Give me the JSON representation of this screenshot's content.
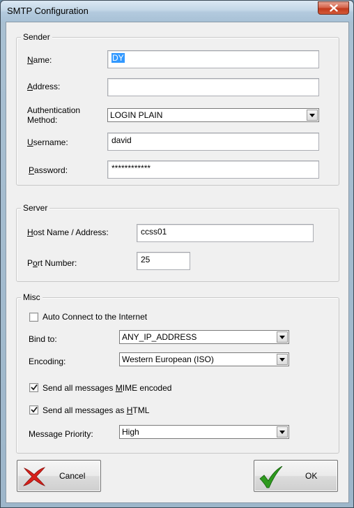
{
  "window": {
    "title": "SMTP Configuration"
  },
  "sender": {
    "legend": "Sender",
    "name_label_pre": "",
    "name_label_ul": "N",
    "name_label_post": "ame:",
    "name_value": "DY",
    "address_label_pre": "",
    "address_label_ul": "A",
    "address_label_post": "ddress:",
    "address_value": "",
    "auth_label_line1": "Authentication",
    "auth_label_line2": "Method:",
    "auth_value": "LOGIN PLAIN",
    "username_label_pre": "",
    "username_label_ul": "U",
    "username_label_post": "sername:",
    "username_value": "david",
    "password_label_pre": "",
    "password_label_ul": "P",
    "password_label_post": "assword:",
    "password_value": "************"
  },
  "server": {
    "legend": "Server",
    "host_label_pre": "",
    "host_label_ul": "H",
    "host_label_post": "ost Name / Address:",
    "host_value": "ccss01",
    "port_label_pre": "P",
    "port_label_ul": "o",
    "port_label_post": "rt Number:",
    "port_value": "25"
  },
  "misc": {
    "legend": "Misc",
    "auto_connect_label": "Auto Connect to the Internet",
    "auto_connect_checked": false,
    "bind_label": "Bind to:",
    "bind_value": "ANY_IP_ADDRESS",
    "encoding_label": "Encoding:",
    "encoding_value": "Western European (ISO)",
    "mime_label_pre": "Send all messages ",
    "mime_label_ul": "M",
    "mime_label_post": "IME encoded",
    "mime_checked": true,
    "html_label_pre": "Send all messages as ",
    "html_label_ul": "H",
    "html_label_post": "TML",
    "html_checked": true,
    "priority_label": "Message Priority:",
    "priority_value": "High"
  },
  "buttons": {
    "cancel_label": "Cancel",
    "ok_label": "OK"
  },
  "icons": {
    "close": "close-icon",
    "cancel": "red-x-icon",
    "ok": "green-checkmark-icon",
    "dropdown": "chevron-down-icon"
  },
  "colors": {
    "selection": "#3399ff",
    "ok_green": "#2e9a1e",
    "cancel_red": "#d8201a",
    "close_red": "#c23a1c"
  }
}
